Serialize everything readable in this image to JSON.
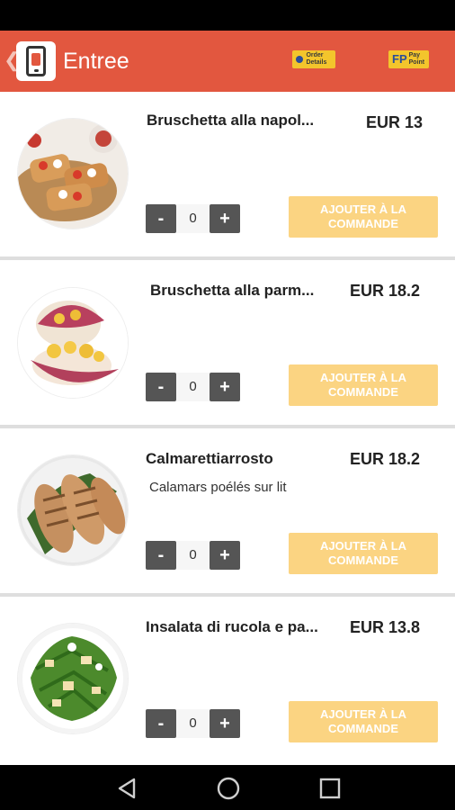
{
  "app_bar": {
    "title": "Entree",
    "back_icon": "chevron-left-icon",
    "logo_icon": "phone-menu-logo-icon",
    "badges": [
      {
        "icon": "order-details-icon",
        "label": "Order Details"
      },
      {
        "icon": "pay-point-icon",
        "label": "Pay Point",
        "mark": "FP"
      }
    ],
    "accent_color": "#e2573f"
  },
  "items": [
    {
      "name": "Bruschetta alla napol...",
      "description": "",
      "price": "EUR 13",
      "quantity": "0",
      "minus_label": "-",
      "plus_label": "+",
      "add_label": "AJOUTER À LA COMMANDE"
    },
    {
      "name": "Bruschetta alla parm...",
      "description": "",
      "price": "EUR 18.2",
      "quantity": "0",
      "minus_label": "-",
      "plus_label": "+",
      "add_label": "AJOUTER À LA COMMANDE"
    },
    {
      "name": "Calmarettiarrosto",
      "description": "Calamars poélés sur lit",
      "price": "EUR 18.2",
      "quantity": "0",
      "minus_label": "-",
      "plus_label": "+",
      "add_label": "AJOUTER À LA COMMANDE"
    },
    {
      "name": "Insalata di rucola e pa...",
      "description": "",
      "price": "EUR 13.8",
      "quantity": "0",
      "minus_label": "-",
      "plus_label": "+",
      "add_label": "AJOUTER À LA COMMANDE"
    }
  ],
  "nav_bar": {
    "back_icon": "nav-back-icon",
    "home_icon": "nav-home-icon",
    "recents_icon": "nav-recents-icon"
  },
  "colors": {
    "add_button": "#fbd482",
    "stepper": "#555555",
    "badge": "#f3c52c"
  }
}
